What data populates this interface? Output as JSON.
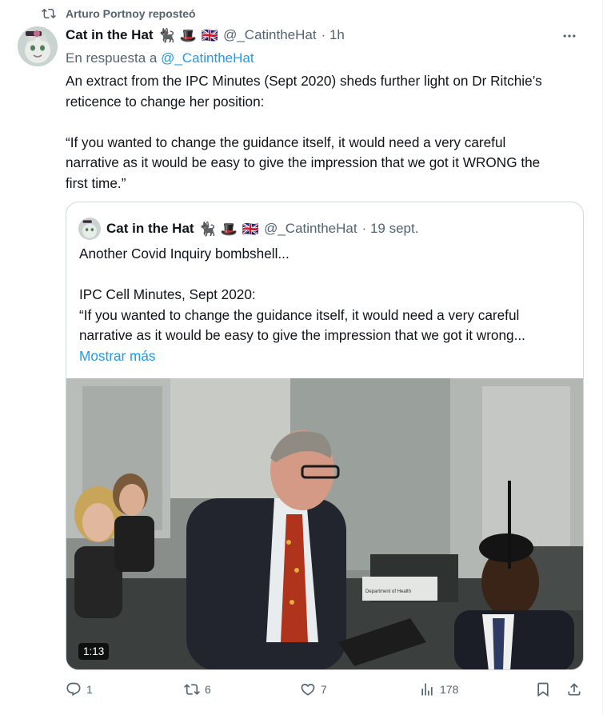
{
  "repost": {
    "label": "Arturo Portnoy reposteó",
    "icon": "repost-icon"
  },
  "tweet": {
    "author_name": "Cat in the Hat",
    "emojis": [
      "🐈‍⬛",
      "🎩",
      "🇬🇧"
    ],
    "handle": "@_CatintheHat",
    "time": "· 1h",
    "reply_prefix": "En respuesta a",
    "reply_handle": "@_CatintheHat",
    "text_lines": [
      "An extract from the IPC Minutes (Sept 2020) sheds further light on Dr Ritchie’s",
      "reticence to change her position:",
      "“If you wanted to change the guidance itself, it would need a very careful",
      "narrative as it would be easy to give the impression that we got it WRONG the",
      "first time.”"
    ]
  },
  "quote": {
    "author_name": "Cat in the Hat",
    "emojis": [
      "🐈‍⬛",
      "🎩",
      "🇬🇧"
    ],
    "handle": "@_CatintheHat",
    "time": "· 19 sept.",
    "text_lines": [
      "Another Covid Inquiry bombshell...",
      "IPC Cell Minutes, Sept 2020:",
      "“If you wanted to change the guidance itself, it would need a very careful",
      "narrative as it would be easy to give the impression that we got it wrong..."
    ],
    "show_more": "Mostrar más",
    "video_duration": "1:13",
    "video_sign": "Department of Health"
  },
  "actions": {
    "replies": "1",
    "reposts": "6",
    "likes": "7",
    "views": "178"
  },
  "colors": {
    "accent": "#1d9bf0",
    "muted": "#536471",
    "text": "#0f1419",
    "border": "#cfd9de"
  }
}
